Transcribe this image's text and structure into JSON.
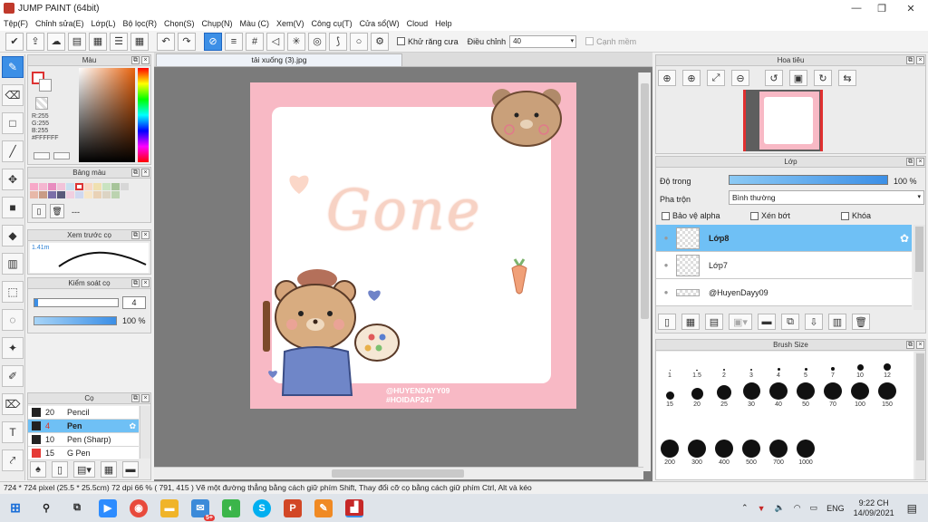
{
  "window": {
    "title": "JUMP PAINT (64bit)",
    "min": "—",
    "max": "❐",
    "close": "✕"
  },
  "menu": [
    "Tệp(F)",
    "Chỉnh sửa(E)",
    "Lớp(L)",
    "Bộ lọc(R)",
    "Chọn(S)",
    "Chụp(N)",
    "Màu (C)",
    "Xem(V)",
    "Công cụ(T)",
    "Cửa sổ(W)",
    "Cloud",
    "Help"
  ],
  "toolbar": {
    "antialias_label": "Khử răng cưa",
    "adjust_label": "Điều chỉnh",
    "adjust_value": "40",
    "edge_label": "Cạnh mềm"
  },
  "panels": {
    "color": {
      "title": "Màu",
      "r": "R:255",
      "g": "G:255",
      "b": "B:255",
      "hex": "#FFFFFF"
    },
    "palette": {
      "title": "Bảng màu",
      "footer": "---"
    },
    "preview": {
      "title": "Xem trước cọ",
      "size": "1.41m"
    },
    "control": {
      "title": "Kiểm soát cọ",
      "size_value": "4",
      "opacity_value": "100 %",
      "opacity": 1.0
    },
    "brush": {
      "title": "Cọ",
      "items": [
        {
          "size": "20",
          "name": "Pencil",
          "color": "#222222",
          "selected": false
        },
        {
          "size": "4",
          "name": "Pen",
          "color": "#222222",
          "selected": true
        },
        {
          "size": "10",
          "name": "Pen (Sharp)",
          "color": "#222222",
          "selected": false
        },
        {
          "size": "15",
          "name": "G Pen",
          "color": "#e53935",
          "selected": false
        }
      ]
    },
    "navigator": {
      "title": "Hoa tiêu"
    },
    "layer": {
      "title": "Lớp",
      "opacity_label": "Độ trong",
      "opacity_value": "100 %",
      "opacity": 1.0,
      "blend_label": "Pha trộn",
      "blend_value": "Bình thường",
      "protect_alpha": "Bảo vệ alpha",
      "clip": "Xén bớt",
      "lock": "Khóa",
      "layers": [
        {
          "name": "Lớp8",
          "selected": true
        },
        {
          "name": "Lớp7",
          "selected": false
        },
        {
          "name": "@HuyenDayy09",
          "selected": false
        }
      ]
    },
    "brushsize": {
      "title": "Brush Size",
      "sizes": [
        "1",
        "1.5",
        "2",
        "3",
        "4",
        "5",
        "7",
        "10",
        "12",
        "15",
        "20",
        "25",
        "30",
        "40",
        "50",
        "70",
        "100",
        "150",
        "200",
        "300",
        "400",
        "500",
        "700",
        "1000"
      ]
    }
  },
  "document": {
    "tab_title": "tải xuống (3).jpg",
    "art_text": "Gone",
    "watermark1": "@HUYENDAYY09",
    "watermark2": "#HOIDAP247"
  },
  "status": "724 * 724 pixel   (25.5 * 25.5cm)   72 dpi   66 %   ( 791, 415 )   Vẽ một đường thẳng bằng cách giữ phím Shift, Thay đổi cỡ cọ bằng cách giữ phím Ctrl, Alt và kéo",
  "taskbar": {
    "lang": "ENG",
    "time": "9:22 CH",
    "date": "14/09/2021",
    "badge": "5+"
  },
  "colors": {
    "accent": "#3c8fe6",
    "selected_row": "#6fc0f5",
    "paper": "#f8b9c5"
  }
}
